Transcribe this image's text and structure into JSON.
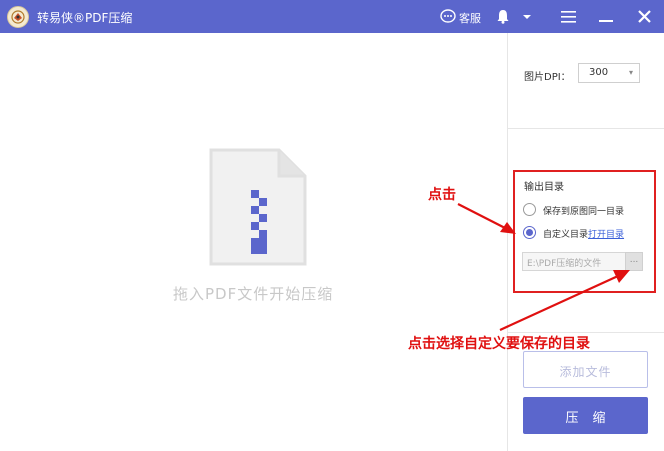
{
  "titlebar": {
    "app_title": "转易侠®PDF压缩",
    "service_label": "客服",
    "icons": [
      "app-logo-icon",
      "chat-bubble-icon",
      "bell-icon",
      "dropdown-arrow-icon",
      "menu-icon",
      "minimize-icon",
      "close-icon"
    ],
    "bg_color": "#5b66cc"
  },
  "main": {
    "drop_hint": "拖入PDF文件开始压缩",
    "icon": "zip-file-icon"
  },
  "sidebar": {
    "dpi_label": "图片DPI：",
    "dpi_value": "300",
    "output_title": "输出目录",
    "option_same": "保存到原图同一目录",
    "option_custom": "自定义目录",
    "open_dir_link": "打开目录",
    "selected_option": "custom",
    "path_placeholder": "E:\\PDF压缩的文件",
    "browse_label": "...",
    "add_file_label": "添加文件",
    "compress_label": "压缩"
  },
  "annotations": {
    "click_label": "点击",
    "choose_label": "点击选择自定义要保存的目录",
    "color": "#e01010"
  }
}
